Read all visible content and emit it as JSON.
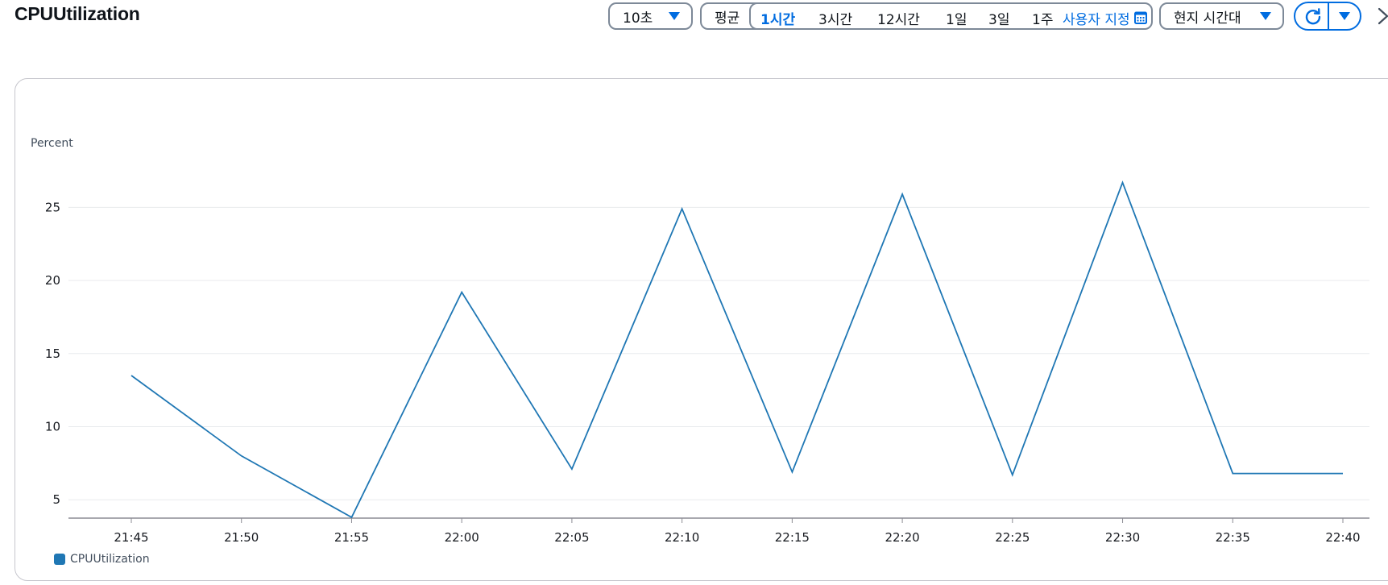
{
  "header": {
    "title": "CPUUtilization",
    "period_label": "10초",
    "statistic_label": "평균",
    "ranges": [
      {
        "label": "1시간",
        "active": true
      },
      {
        "label": "3시간",
        "active": false
      },
      {
        "label": "12시간",
        "active": false
      },
      {
        "label": "1일",
        "active": false
      },
      {
        "label": "3일",
        "active": false
      },
      {
        "label": "1주",
        "active": false
      }
    ],
    "custom_label": "사용자 지정",
    "timezone_label": "현지 시간대",
    "icons": {
      "calendar": "calendar-icon",
      "refresh": "refresh-icon",
      "close": "close-icon",
      "caret": "caret-down-icon"
    }
  },
  "colors": {
    "accent": "#006ce0",
    "series": "#1f77b4",
    "grid": "#e9ebed",
    "axis": "#8c8c94"
  },
  "chart_data": {
    "type": "line",
    "ylabel": "Percent",
    "x": [
      "21:45",
      "21:50",
      "21:55",
      "22:00",
      "22:05",
      "22:10",
      "22:15",
      "22:20",
      "22:25",
      "22:30",
      "22:35",
      "22:40"
    ],
    "yticks": [
      5,
      10,
      15,
      20,
      25
    ],
    "ylim": [
      3.8,
      27.5
    ],
    "grid": true,
    "legend": "bottom-left",
    "series": [
      {
        "name": "CPUUtilization",
        "color": "#1f77b4",
        "values": [
          13.5,
          8.0,
          3.8,
          19.2,
          7.1,
          24.9,
          6.9,
          25.9,
          6.7,
          26.7,
          6.8,
          6.8
        ]
      }
    ]
  }
}
